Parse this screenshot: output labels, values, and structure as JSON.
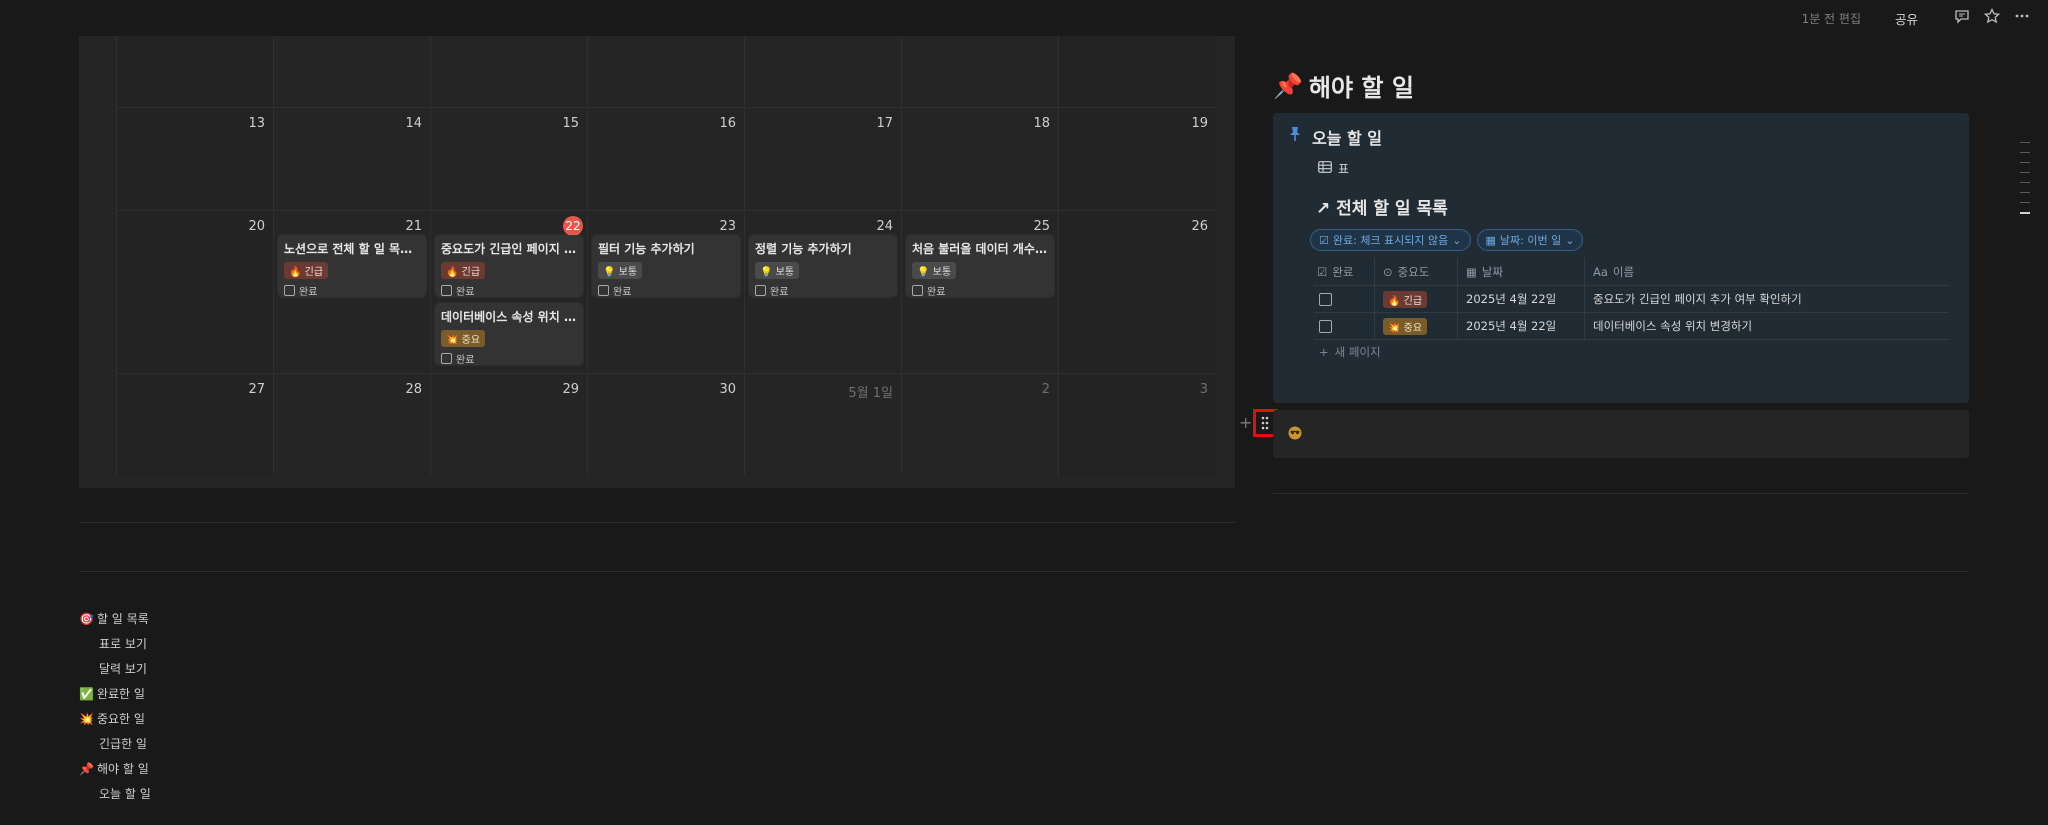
{
  "topbar": {
    "edited": "1분 전 편집",
    "share": "공유"
  },
  "calendar": {
    "weeks": [
      {
        "days": [
          {
            "label": "13"
          },
          {
            "label": "14"
          },
          {
            "label": "15"
          },
          {
            "label": "16"
          },
          {
            "label": "17"
          },
          {
            "label": "18"
          },
          {
            "label": "19"
          }
        ]
      },
      {
        "days": [
          {
            "label": "20"
          },
          {
            "label": "21"
          },
          {
            "label": "22",
            "today": true
          },
          {
            "label": "23"
          },
          {
            "label": "24"
          },
          {
            "label": "25"
          },
          {
            "label": "26"
          }
        ]
      },
      {
        "days": [
          {
            "label": "27"
          },
          {
            "label": "28"
          },
          {
            "label": "29"
          },
          {
            "label": "30"
          },
          {
            "label": "5월 1일",
            "other": true
          },
          {
            "label": "2",
            "other": true
          },
          {
            "label": "3",
            "other": true
          }
        ]
      }
    ],
    "events": [
      {
        "title": "노션으로 전체 할 일 목록 만들기",
        "tag": "🔥 긴급",
        "tagType": "urgent",
        "done": "완료"
      },
      {
        "title": "중요도가 긴급인 페이지 추가 여부 확인하기",
        "tag": "🔥 긴급",
        "tagType": "urgent",
        "done": "완료"
      },
      {
        "title": "데이터베이스 속성 위치 변경하기",
        "tag": "💥 중요",
        "tagType": "important",
        "done": "완료"
      },
      {
        "title": "필터 기능 추가하기",
        "tag": "💡 보통",
        "tagType": "normal",
        "done": "완료"
      },
      {
        "title": "정렬 기능 추가하기",
        "tag": "💡 보통",
        "tagType": "normal",
        "done": "완료"
      },
      {
        "title": "처음 불러올 데이터 개수 지정하기",
        "tag": "💡 보통",
        "tagType": "normal",
        "done": "완료"
      }
    ]
  },
  "todo": {
    "heading": "해야 할 일",
    "callout_title": "오늘 할 일",
    "view_tab": "표",
    "db_title": "전체 할 일 목록",
    "filters": [
      "완료: 체크 표시되지 않음",
      "날짜: 이번 일"
    ],
    "columns": [
      "완료",
      "중요도",
      "날짜",
      "이름"
    ],
    "rows": [
      {
        "tag": "🔥 긴급",
        "tagType": "urgent",
        "date": "2025년 4월 22일",
        "name": "중요도가 긴급인 페이지 추가 여부 확인하기"
      },
      {
        "tag": "💥 중요",
        "tagType": "important",
        "date": "2025년 4월 22일",
        "name": "데이터베이스 속성 위치 변경하기"
      }
    ],
    "new_page": "새 페이지"
  },
  "outline": [
    {
      "icon": "🎯",
      "label": "할 일 목록",
      "sub": false
    },
    {
      "icon": "",
      "label": "표로 보기",
      "sub": true
    },
    {
      "icon": "",
      "label": "달력 보기",
      "sub": true
    },
    {
      "icon": "✅",
      "label": "완료한 일",
      "sub": false
    },
    {
      "icon": "💥",
      "label": "중요한 일",
      "sub": false
    },
    {
      "icon": "",
      "label": "긴급한 일",
      "sub": true
    },
    {
      "icon": "📌",
      "label": "해야 할 일",
      "sub": false
    },
    {
      "icon": "",
      "label": "오늘 할 일",
      "sub": true
    }
  ]
}
